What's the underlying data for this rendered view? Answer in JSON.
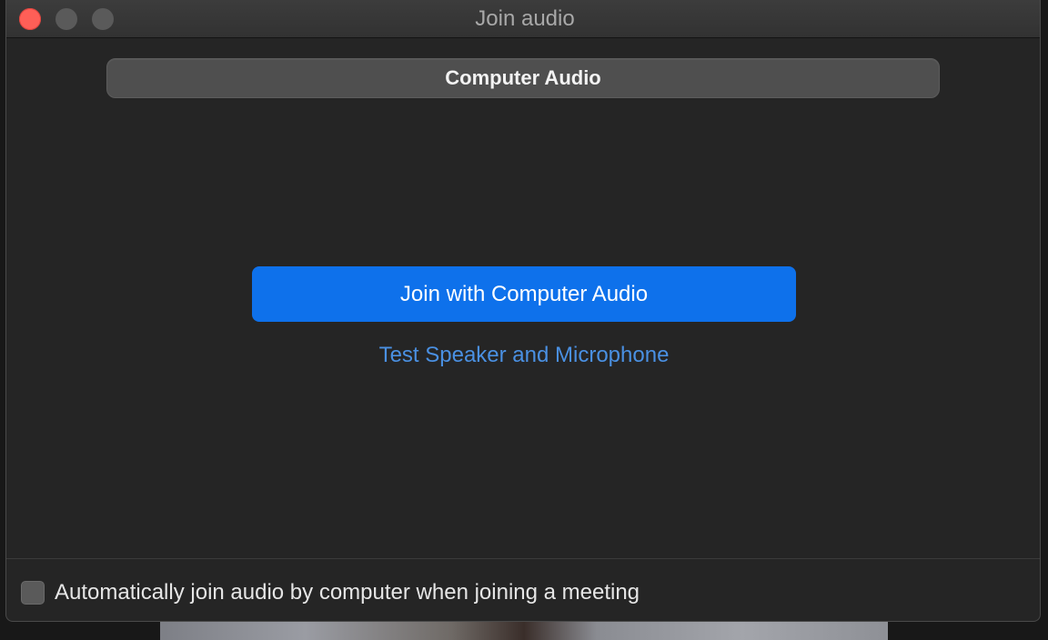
{
  "window": {
    "title": "Join audio"
  },
  "tabs": {
    "active_label": "Computer Audio"
  },
  "main": {
    "join_button_label": "Join with Computer Audio",
    "test_link_label": "Test Speaker and Microphone"
  },
  "footer": {
    "auto_join_label": "Automatically join audio by computer when joining a meeting",
    "auto_join_checked": false
  },
  "colors": {
    "primary_button": "#0e71eb",
    "link": "#4a90e2",
    "close_button": "#fe5f57",
    "window_background": "#252525"
  }
}
